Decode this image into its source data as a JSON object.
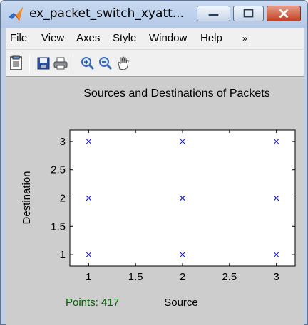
{
  "window": {
    "title": "ex_packet_switch_xyatt...",
    "app_icon": "matlab-logo-icon",
    "buttons": {
      "minimize": "minimize-icon",
      "maximize": "maximize-icon",
      "close": "close-icon"
    }
  },
  "menubar": {
    "items": [
      {
        "label": "File"
      },
      {
        "label": "View"
      },
      {
        "label": "Axes"
      },
      {
        "label": "Style"
      },
      {
        "label": "Window"
      },
      {
        "label": "Help"
      }
    ],
    "overflow_icon": "chevron-right-icon"
  },
  "toolbar": {
    "items": [
      "edit-plot-icon",
      "save-icon",
      "print-icon",
      "zoom-in-icon",
      "zoom-out-icon",
      "pan-hand-icon"
    ]
  },
  "figure": {
    "status_text": "Points: 417",
    "status_color": "#006400"
  },
  "chart_data": {
    "type": "scatter",
    "title": "Sources and Destinations of Packets",
    "xlabel": "Source",
    "ylabel": "Destination",
    "xlim": [
      0.8,
      3.2
    ],
    "ylim": [
      0.8,
      3.2
    ],
    "xticks": [
      "1",
      "1.5",
      "2",
      "2.5",
      "3"
    ],
    "xtick_values": [
      1,
      1.5,
      2,
      2.5,
      3
    ],
    "yticks": [
      "1",
      "1.5",
      "2",
      "2.5",
      "3"
    ],
    "ytick_values": [
      1,
      1.5,
      2,
      2.5,
      3
    ],
    "marker": "x",
    "marker_color": "#0000ff",
    "grid": false,
    "points": [
      {
        "x": 1,
        "y": 1
      },
      {
        "x": 1,
        "y": 2
      },
      {
        "x": 1,
        "y": 3
      },
      {
        "x": 2,
        "y": 1
      },
      {
        "x": 2,
        "y": 2
      },
      {
        "x": 2,
        "y": 3
      },
      {
        "x": 3,
        "y": 1
      },
      {
        "x": 3,
        "y": 2
      },
      {
        "x": 3,
        "y": 3
      }
    ]
  }
}
